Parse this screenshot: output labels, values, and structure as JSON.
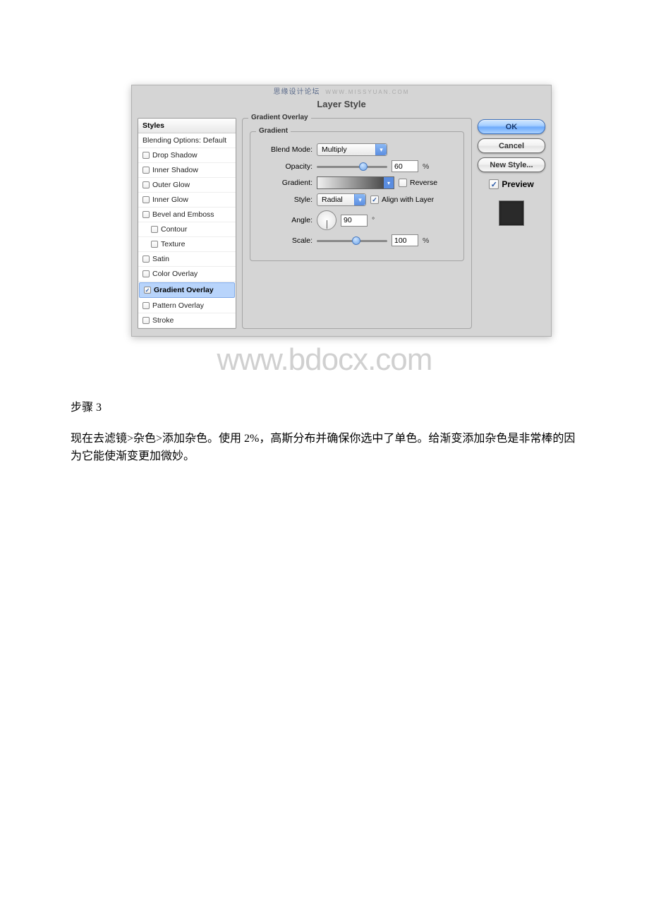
{
  "watermark_top": {
    "cn": "思缘设计论坛",
    "url": "WWW.MISSYUAN.COM"
  },
  "dialog": {
    "title": "Layer Style",
    "fieldset_outer": "Gradient Overlay",
    "fieldset_inner": "Gradient",
    "sidebar": {
      "header": "Styles",
      "options": "Blending Options: Default",
      "items": [
        {
          "label": "Drop Shadow",
          "checked": false
        },
        {
          "label": "Inner Shadow",
          "checked": false
        },
        {
          "label": "Outer Glow",
          "checked": false
        },
        {
          "label": "Inner Glow",
          "checked": false
        },
        {
          "label": "Bevel and Emboss",
          "checked": false
        },
        {
          "label": "Contour",
          "checked": false,
          "sub": true
        },
        {
          "label": "Texture",
          "checked": false,
          "sub": true
        },
        {
          "label": "Satin",
          "checked": false
        },
        {
          "label": "Color Overlay",
          "checked": false
        },
        {
          "label": "Gradient Overlay",
          "checked": true,
          "selected": true
        },
        {
          "label": "Pattern Overlay",
          "checked": false
        },
        {
          "label": "Stroke",
          "checked": false
        }
      ]
    },
    "blend_mode": {
      "label": "Blend Mode:",
      "value": "Multiply"
    },
    "opacity": {
      "label": "Opacity:",
      "value": "60",
      "unit": "%",
      "pct": 60
    },
    "gradient": {
      "label": "Gradient:",
      "reverse_label": "Reverse",
      "reverse_checked": false
    },
    "style": {
      "label": "Style:",
      "value": "Radial",
      "align_label": "Align with Layer",
      "align_checked": true
    },
    "angle": {
      "label": "Angle:",
      "value": "90",
      "unit": "°"
    },
    "scale": {
      "label": "Scale:",
      "value": "100",
      "unit": "%",
      "pct": 50
    },
    "buttons": {
      "ok": "OK",
      "cancel": "Cancel",
      "new_style": "New Style..."
    },
    "preview": {
      "label": "Preview",
      "checked": true
    }
  },
  "big_watermark": "www.bdocx.com",
  "article": {
    "step_label": "步骤 3",
    "body": "现在去滤镜>杂色>添加杂色。使用 2%，高斯分布并确保你选中了单色。给渐变添加杂色是非常棒的因为它能使渐变更加微妙。"
  }
}
